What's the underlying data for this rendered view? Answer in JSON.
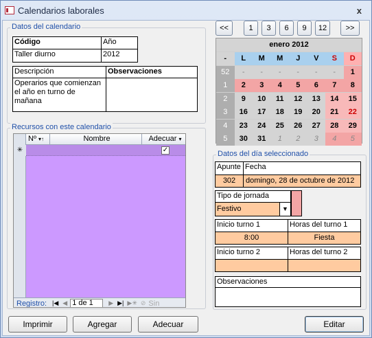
{
  "window": {
    "title": "Calendarios laborales",
    "close_label": "x"
  },
  "datos_calendario": {
    "group_title": "Datos del calendario",
    "codigo_label": "Código",
    "anio_label": "Año",
    "codigo_value": "Taller diurno",
    "anio_value": "2012",
    "descripcion_label": "Descripción",
    "observaciones_label": "Observaciones",
    "descripcion_value_1": "Operarios que comienzan",
    "descripcion_value_2": "el año en turno de mañana",
    "observaciones_value": ""
  },
  "recursos": {
    "group_title": "Recursos con este calendario",
    "columns": [
      "Nº",
      "Nombre",
      "Adecuar"
    ],
    "new_row_marker": "✳",
    "adecuar_checked": true,
    "nav": {
      "label": "Registro:",
      "current": "1 de 1",
      "search": "Sin"
    }
  },
  "calendar_nav": {
    "buttons": [
      "<<",
      "1",
      "3",
      "6",
      "9",
      "12",
      ">>"
    ]
  },
  "calendar": {
    "month_title": "enero 2012",
    "headers": [
      "-",
      "L",
      "M",
      "M",
      "J",
      "V",
      "S",
      "D"
    ],
    "weeks": [
      {
        "wk": "52",
        "days": [
          "-",
          "-",
          "-",
          "-",
          "-",
          "-",
          "1"
        ]
      },
      {
        "wk": "1",
        "days": [
          "2",
          "3",
          "4",
          "5",
          "6",
          "7",
          "8"
        ]
      },
      {
        "wk": "2",
        "days": [
          "9",
          "10",
          "11",
          "12",
          "13",
          "14",
          "15"
        ]
      },
      {
        "wk": "3",
        "days": [
          "16",
          "17",
          "18",
          "19",
          "20",
          "21",
          "22"
        ]
      },
      {
        "wk": "4",
        "days": [
          "23",
          "24",
          "25",
          "26",
          "27",
          "28",
          "29"
        ]
      },
      {
        "wk": "5",
        "days": [
          "30",
          "31",
          "1",
          "2",
          "3",
          "4",
          "5"
        ]
      }
    ]
  },
  "dia": {
    "group_title": "Datos del día seleccionado",
    "apunte_label": "Apunte",
    "fecha_label": "Fecha",
    "apunte_value": "302",
    "fecha_value": "domingo, 28 de octubre de 2012",
    "tipo_label": "Tipo de jornada",
    "tipo_value": "Festivo",
    "inicio1_label": "Inicio turno 1",
    "horas1_label": "Horas del turno 1",
    "inicio1_value": "8:00",
    "horas1_value": "Fiesta",
    "inicio2_label": "Inicio turno 2",
    "horas2_label": "Horas del turno 2",
    "inicio2_value": "",
    "horas2_value": "",
    "observaciones_label": "Observaciones"
  },
  "buttons": {
    "imprimir": "Imprimir",
    "agregar": "Agregar",
    "adecuar": "Adecuar",
    "editar": "Editar"
  }
}
